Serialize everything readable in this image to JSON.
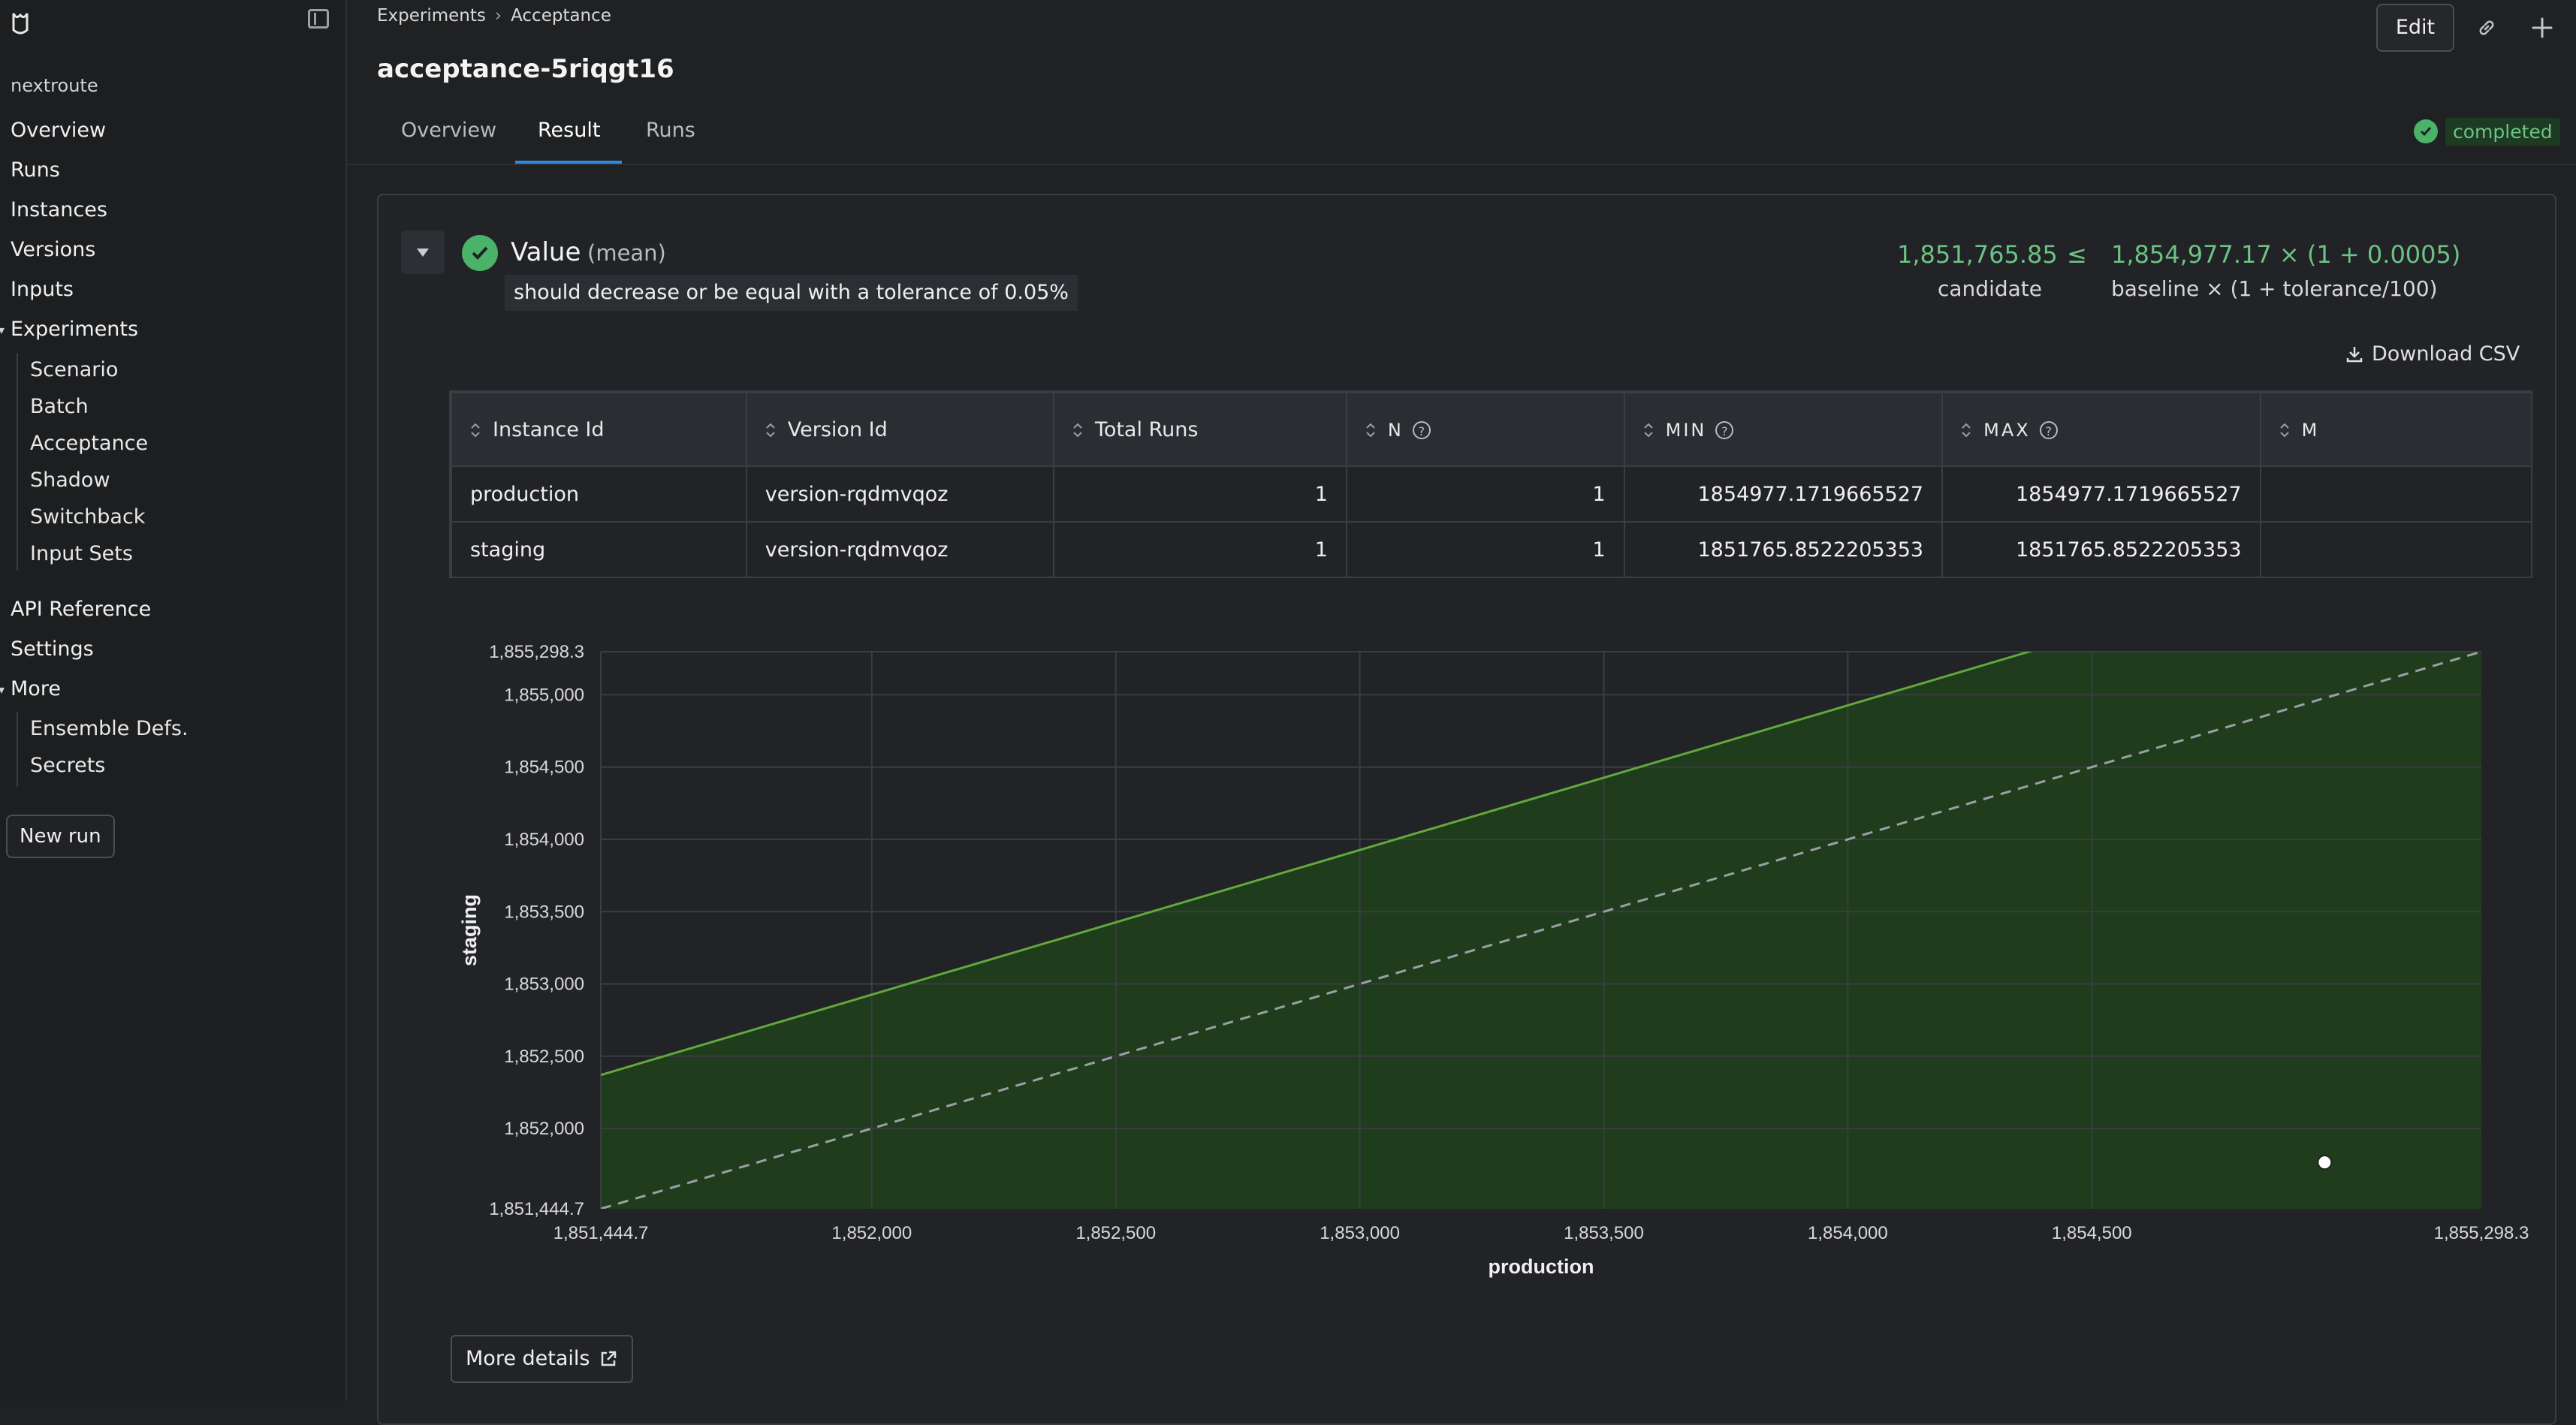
{
  "sidebar": {
    "org": "nextroute",
    "items": [
      {
        "label": "Overview"
      },
      {
        "label": "Runs"
      },
      {
        "label": "Instances"
      },
      {
        "label": "Versions"
      },
      {
        "label": "Inputs"
      },
      {
        "label": "Experiments"
      }
    ],
    "experiments_children": [
      "Scenario",
      "Batch",
      "Acceptance",
      "Shadow",
      "Switchback",
      "Input Sets"
    ],
    "api_reference": "API Reference",
    "settings": "Settings",
    "more": "More",
    "more_children": [
      "Ensemble Defs.",
      "Secrets"
    ],
    "new_run": "New run"
  },
  "header": {
    "breadcrumb": [
      "Experiments",
      "Acceptance"
    ],
    "title": "acceptance-5riqgt16",
    "edit_label": "Edit",
    "tabs": [
      "Overview",
      "Result",
      "Runs"
    ],
    "active_tab": "Result",
    "status": "completed"
  },
  "result": {
    "metric_name": "Value",
    "metric_aggregation": "(mean)",
    "criterion": "should decrease or be equal with a tolerance of 0.05%",
    "candidate_value": "1,851,765.85",
    "candidate_label": "candidate",
    "comparator": "≤",
    "baseline_value": "1,854,977.17 × (1 + 0.0005)",
    "baseline_label": "baseline × (1 + tolerance/100)",
    "download_csv": "Download CSV",
    "more_details": "More details"
  },
  "table": {
    "headers": [
      "Instance Id",
      "Version Id",
      "Total Runs",
      "N",
      "MIN",
      "MAX",
      "M"
    ],
    "rows": [
      [
        "production",
        "version-rqdmvqoz",
        "1",
        "1",
        "1854977.1719665527",
        "1854977.1719665527"
      ],
      [
        "staging",
        "version-rqdmvqoz",
        "1",
        "1",
        "1851765.8522205353",
        "1851765.8522205353"
      ]
    ]
  },
  "colors": {
    "accent": "#2f8be0",
    "success": "#4bb26a",
    "success_text": "#6cc384",
    "chart_fill": "#1f3d1c",
    "chart_line": "#62a83c"
  },
  "chart_data": {
    "type": "scatter",
    "xlabel": "production",
    "ylabel": "staging",
    "xlim": [
      1851444.7,
      1855298.3
    ],
    "ylim": [
      1851444.7,
      1855298.3
    ],
    "x_ticks": [
      "1,851,444.7",
      "1,852,000",
      "1,852,500",
      "1,853,000",
      "1,853,500",
      "1,854,000",
      "1,854,500",
      "1,855,298.3"
    ],
    "x_tick_values": [
      1851444.7,
      1852000,
      1852500,
      1853000,
      1853500,
      1854000,
      1854500,
      1855298.3
    ],
    "y_ticks": [
      "1,855,298.3",
      "1,855,000",
      "1,854,500",
      "1,854,000",
      "1,853,500",
      "1,853,000",
      "1,852,500",
      "1,852,000",
      "1,851,444.7"
    ],
    "y_tick_values": [
      1855298.3,
      1855000,
      1854500,
      1854000,
      1853500,
      1853000,
      1852500,
      1852000,
      1851444.7
    ],
    "points": [
      {
        "x": 1854977.17,
        "y": 1851765.85
      }
    ],
    "reference_line_slope": 1,
    "tolerance_line_slope": 1.0005,
    "grid": true
  }
}
